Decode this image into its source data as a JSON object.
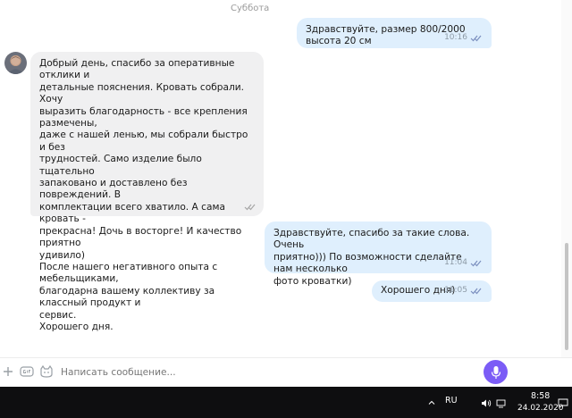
{
  "chat": {
    "day_label": "Суббота",
    "messages": [
      {
        "direction": "outgoing",
        "text": "Здравствуйте, размер 800/2000 высота 20 см",
        "time": "10:16",
        "status": "read"
      },
      {
        "direction": "incoming",
        "text": "Добрый день, спасибо за оперативные отклики и\nдетальные пояснения. Кровать собрали. Хочу\nвыразить благодарность - все крепления размечены,\nдаже с нашей ленью, мы собрали быстро и без\nтрудностей. Само изделие было тщательно\nзапаковано и доставлено без повреждений. В\nкомплектации всего хватило. А сама кровать -\nпрекрасна! Дочь в восторге! И качество приятно\nудивило)\nПосле нашего негативного опыта с мебельщиками,\nблагодарна вашему коллективу за классный продукт и\nсервис.\nХорошего дня.",
        "status": "delivered"
      },
      {
        "direction": "outgoing",
        "text": "Здравствуйте, спасибо за такие слова. Очень\nприятно))) По возможности сделайте нам несколько\nфото кроватки)",
        "time": "11:04",
        "status": "read"
      },
      {
        "direction": "outgoing",
        "text": "Хорошего дня)",
        "time": "11:05",
        "status": "read"
      }
    ]
  },
  "composer": {
    "placeholder": "Написать сообщение...",
    "icons": [
      "plus-icon",
      "gif-icon",
      "sticker-icon",
      "microphone-icon"
    ],
    "accent_color": "#7b5cf6"
  },
  "taskbar": {
    "language": "RU",
    "time": "8:58",
    "date": "24.02.2020",
    "icons": [
      "chevron-up-icon",
      "speaker-icon",
      "network-icon",
      "notification-icon"
    ]
  }
}
